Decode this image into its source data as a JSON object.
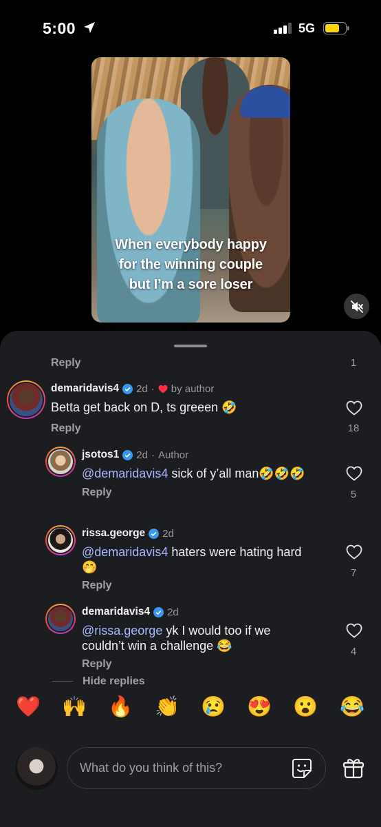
{
  "status_bar": {
    "time": "5:00",
    "network": "5G"
  },
  "video": {
    "caption_lines": [
      "When everybody happy",
      "for the winning couple",
      "but I’m a sore loser"
    ]
  },
  "top_reply": {
    "reply_label": "Reply",
    "like_count": "1"
  },
  "comments": [
    {
      "username": "demaridavis4",
      "time": "2d",
      "separator": "·",
      "badge_text": "by author",
      "text": "Betta get back on D, ts greeen",
      "emoji": "🤣",
      "reply_label": "Reply",
      "like_count": "18"
    },
    {
      "username": "jsotos1",
      "time": "2d",
      "separator": "·",
      "badge_text": "Author",
      "mention": "@demaridavis4",
      "text": " sick of y’all man",
      "emoji": "🤣🤣🤣",
      "reply_label": "Reply",
      "like_count": "5"
    },
    {
      "username": "rissa.george",
      "time": "2d",
      "mention": "@demaridavis4",
      "text": " haters were hating hard",
      "emoji": "🤭",
      "reply_label": "Reply",
      "like_count": "7"
    },
    {
      "username": "demaridavis4",
      "time": "2d",
      "mention": "@rissa.george",
      "text": " yk I would too if we",
      "text2": "couldn’t win a challenge",
      "emoji": "😂",
      "reply_label": "Reply",
      "like_count": "4"
    }
  ],
  "hide_replies_label": "Hide replies",
  "quick_reactions": [
    "❤️",
    "🙌",
    "🔥",
    "👏",
    "😢",
    "😍",
    "😮",
    "😂"
  ],
  "input": {
    "placeholder": "What do you think of this?"
  },
  "icons": {
    "location": "location-arrow-icon",
    "mute": "speaker-muted-icon",
    "heart": "heart-outline-icon",
    "sticker": "sticker-icon",
    "gift": "gift-icon",
    "verified": "verified-badge-icon"
  },
  "colors": {
    "verified": "#3897f0",
    "mention": "#a9b9ff",
    "author_heart": "#ff3040",
    "battery": "#ffd60a"
  }
}
